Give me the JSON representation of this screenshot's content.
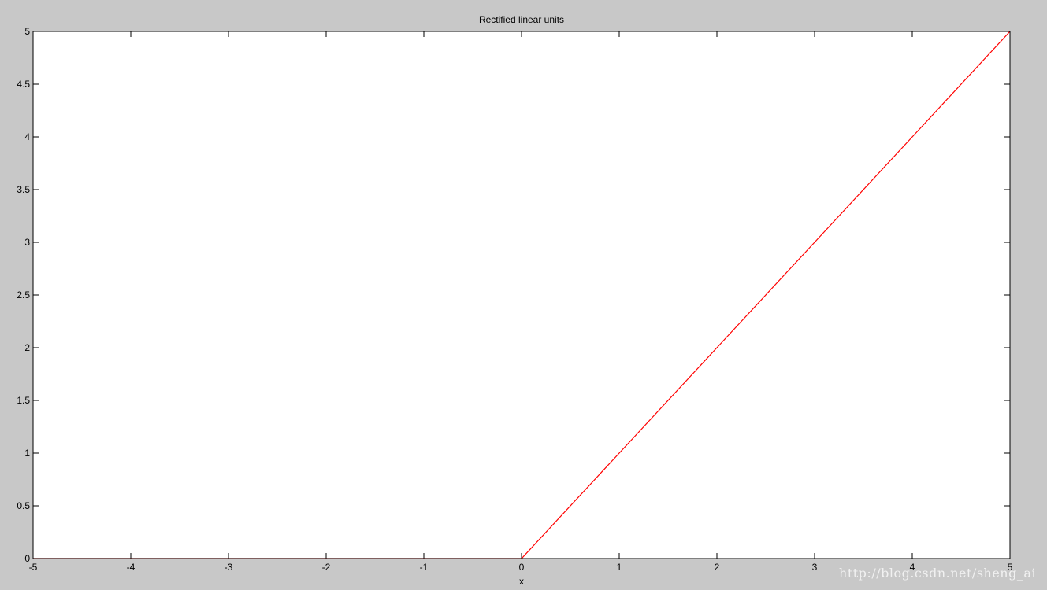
{
  "watermark": "http://blog.csdn.net/sheng_ai",
  "chart_data": {
    "type": "line",
    "title": "Rectified linear units",
    "xlabel": "x",
    "ylabel": "",
    "xlim": [
      -5,
      5
    ],
    "ylim": [
      0,
      5
    ],
    "xticks": [
      -5,
      -4,
      -3,
      -2,
      -1,
      0,
      1,
      2,
      3,
      4,
      5
    ],
    "xtick_labels": [
      "-5",
      "-4",
      "-3",
      "-2",
      "-1",
      "0",
      "1",
      "2",
      "3",
      "4",
      "5"
    ],
    "yticks": [
      0,
      0.5,
      1,
      1.5,
      2,
      2.5,
      3,
      3.5,
      4,
      4.5,
      5
    ],
    "ytick_labels": [
      "0",
      "0.5",
      "1",
      "1.5",
      "2",
      "2.5",
      "3",
      "3.5",
      "4",
      "4.5",
      "5"
    ],
    "grid": false,
    "series": [
      {
        "color": "#ff0000",
        "x": [
          -5,
          -4,
          -3,
          -2,
          -1,
          0,
          1,
          2,
          3,
          4,
          5
        ],
        "y": [
          0,
          0,
          0,
          0,
          0,
          0,
          1,
          2,
          3,
          4,
          5
        ]
      }
    ]
  }
}
